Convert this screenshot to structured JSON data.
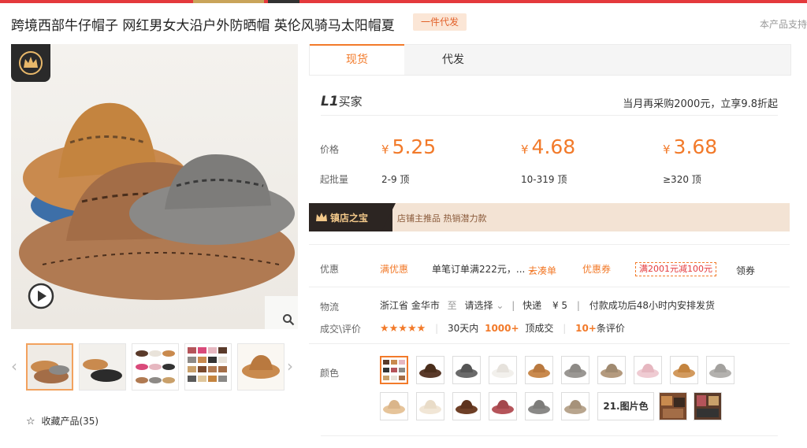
{
  "header": {
    "title": "跨境西部牛仔帽子 网红男女大沿户外防晒帽 英伦风骑马太阳帽夏",
    "badge": "一件代发",
    "report": "本产品支持"
  },
  "gallery": {
    "favorite_label": "收藏产品(35)"
  },
  "tabs": [
    {
      "label": "现货",
      "active": true
    },
    {
      "label": "代发",
      "active": false
    }
  ],
  "buyer": {
    "level": "L1",
    "label": "买家",
    "promo": "当月再采购2000元，立享9.8折起"
  },
  "pricing": {
    "price_label": "价格",
    "moq_label": "起批量",
    "currency": "¥",
    "tiers": [
      {
        "price": "5.25",
        "range": "2-9 顶"
      },
      {
        "price": "4.68",
        "range": "10-319 顶"
      },
      {
        "price": "3.68",
        "range": "≥320 顶"
      }
    ]
  },
  "store_banner": {
    "name": "镇店之宝",
    "tags": "店铺主推品   热销潜力款"
  },
  "discount": {
    "label": "优惠",
    "full_discount": "满优惠",
    "rule": "单笔订单满222元，...",
    "combine": "去凑单",
    "coupon_label": "优惠券",
    "coupon": "满2001元减100元",
    "get_coupon": "领券"
  },
  "logistics": {
    "label": "物流",
    "origin": "浙江省 金华市",
    "to": "至",
    "dest": "请选择",
    "express": "快递",
    "fee": "¥ 5",
    "ship_note": "付款成功后48小时内安排发货"
  },
  "deals": {
    "label": "成交\\评价",
    "stars": "★★★★★",
    "days": "30天内",
    "count": "1000+",
    "count_unit": "顶成交",
    "reviews": "10+",
    "reviews_unit": "条评价"
  },
  "color": {
    "label": "颜色",
    "more_label": "21.图片色"
  },
  "colors": {
    "tan": "#c98a4e",
    "brown": "#7a4a2e",
    "gray": "#8d8a86",
    "light": "#e9e3da",
    "pink": "#e6b7c0",
    "khaki": "#c9a06a",
    "dark": "#5a3a2a",
    "rose": "#b5545a",
    "accent": "#f27a2a"
  }
}
